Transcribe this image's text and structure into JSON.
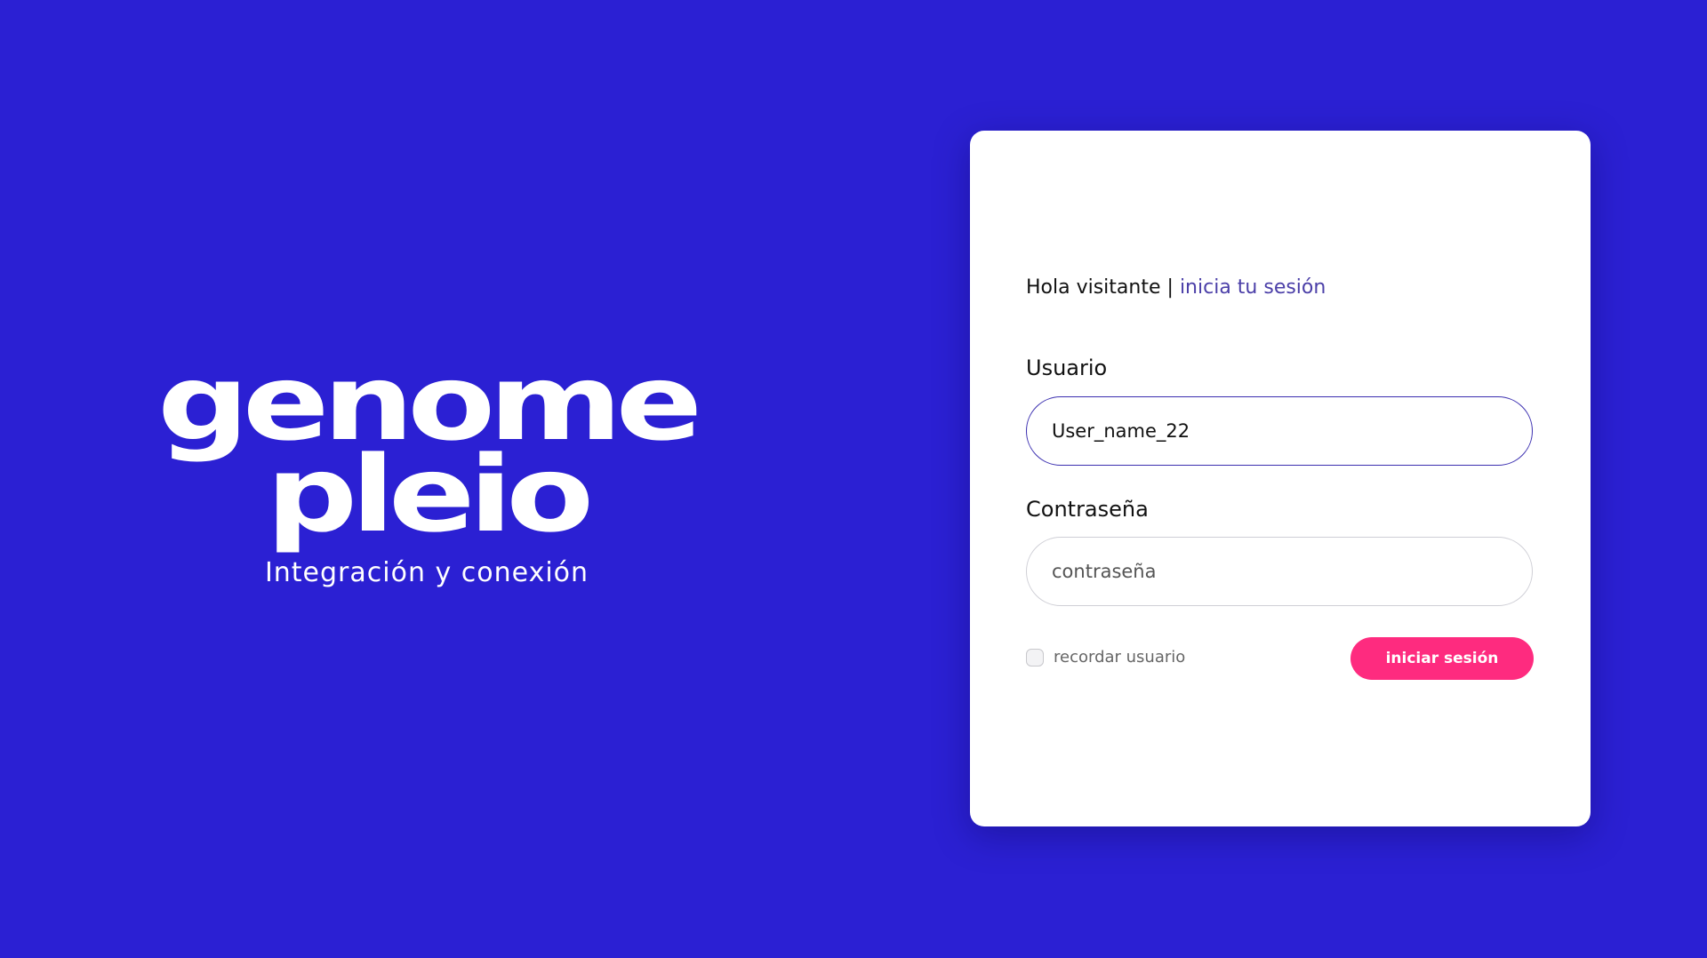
{
  "brand": {
    "logo_line1": "genome",
    "logo_line2": "pleio",
    "tagline": "Integración y conexión"
  },
  "login": {
    "greeting": "Hola visitante",
    "separator": "|",
    "greeting_link": "inicia tu sesión",
    "username_label": "Usuario",
    "username_value": "User_name_22",
    "password_label": "Contraseña",
    "password_placeholder": "contraseña",
    "remember_label": "recordar usuario",
    "remember_checked": false,
    "submit_label": "iniciar sesión"
  },
  "colors": {
    "background": "#2b20d3",
    "card": "#ffffff",
    "accent": "#fe2b7f",
    "link": "#4b3fa8",
    "focused_border": "#3b2fb0"
  }
}
